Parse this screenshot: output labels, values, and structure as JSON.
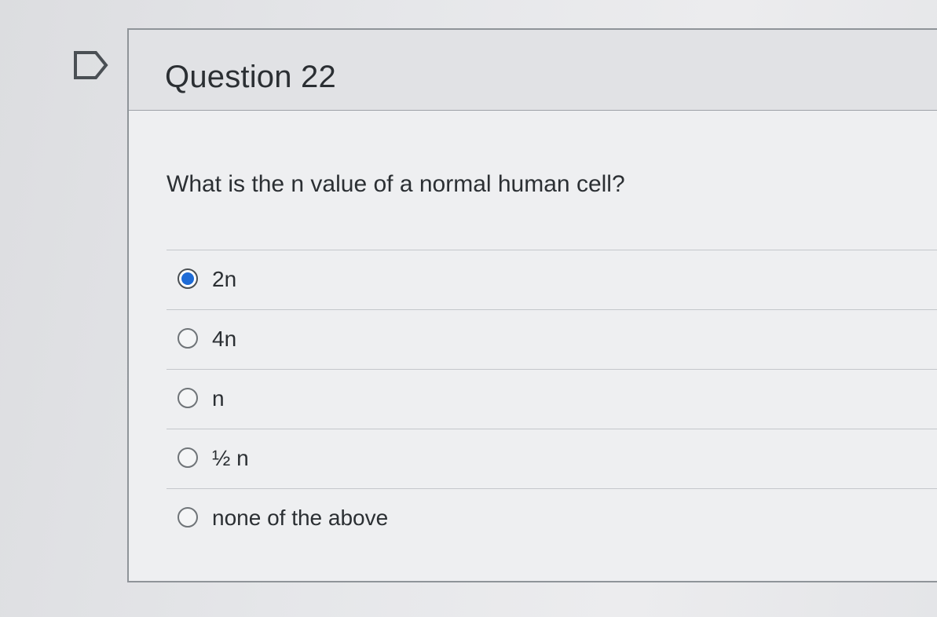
{
  "question": {
    "title": "Question 22",
    "text": "What is the n value of a normal human cell?",
    "flag_icon": "flag-outline-icon"
  },
  "answers": [
    {
      "label": "2n",
      "selected": true
    },
    {
      "label": "4n",
      "selected": false
    },
    {
      "label": "n",
      "selected": false
    },
    {
      "label": "½ n",
      "selected": false
    },
    {
      "label": "none of the above",
      "selected": false
    }
  ],
  "colors": {
    "selected_radio": "#1e6bd6",
    "text": "#2b2f33",
    "header_bg": "#e1e2e5"
  }
}
